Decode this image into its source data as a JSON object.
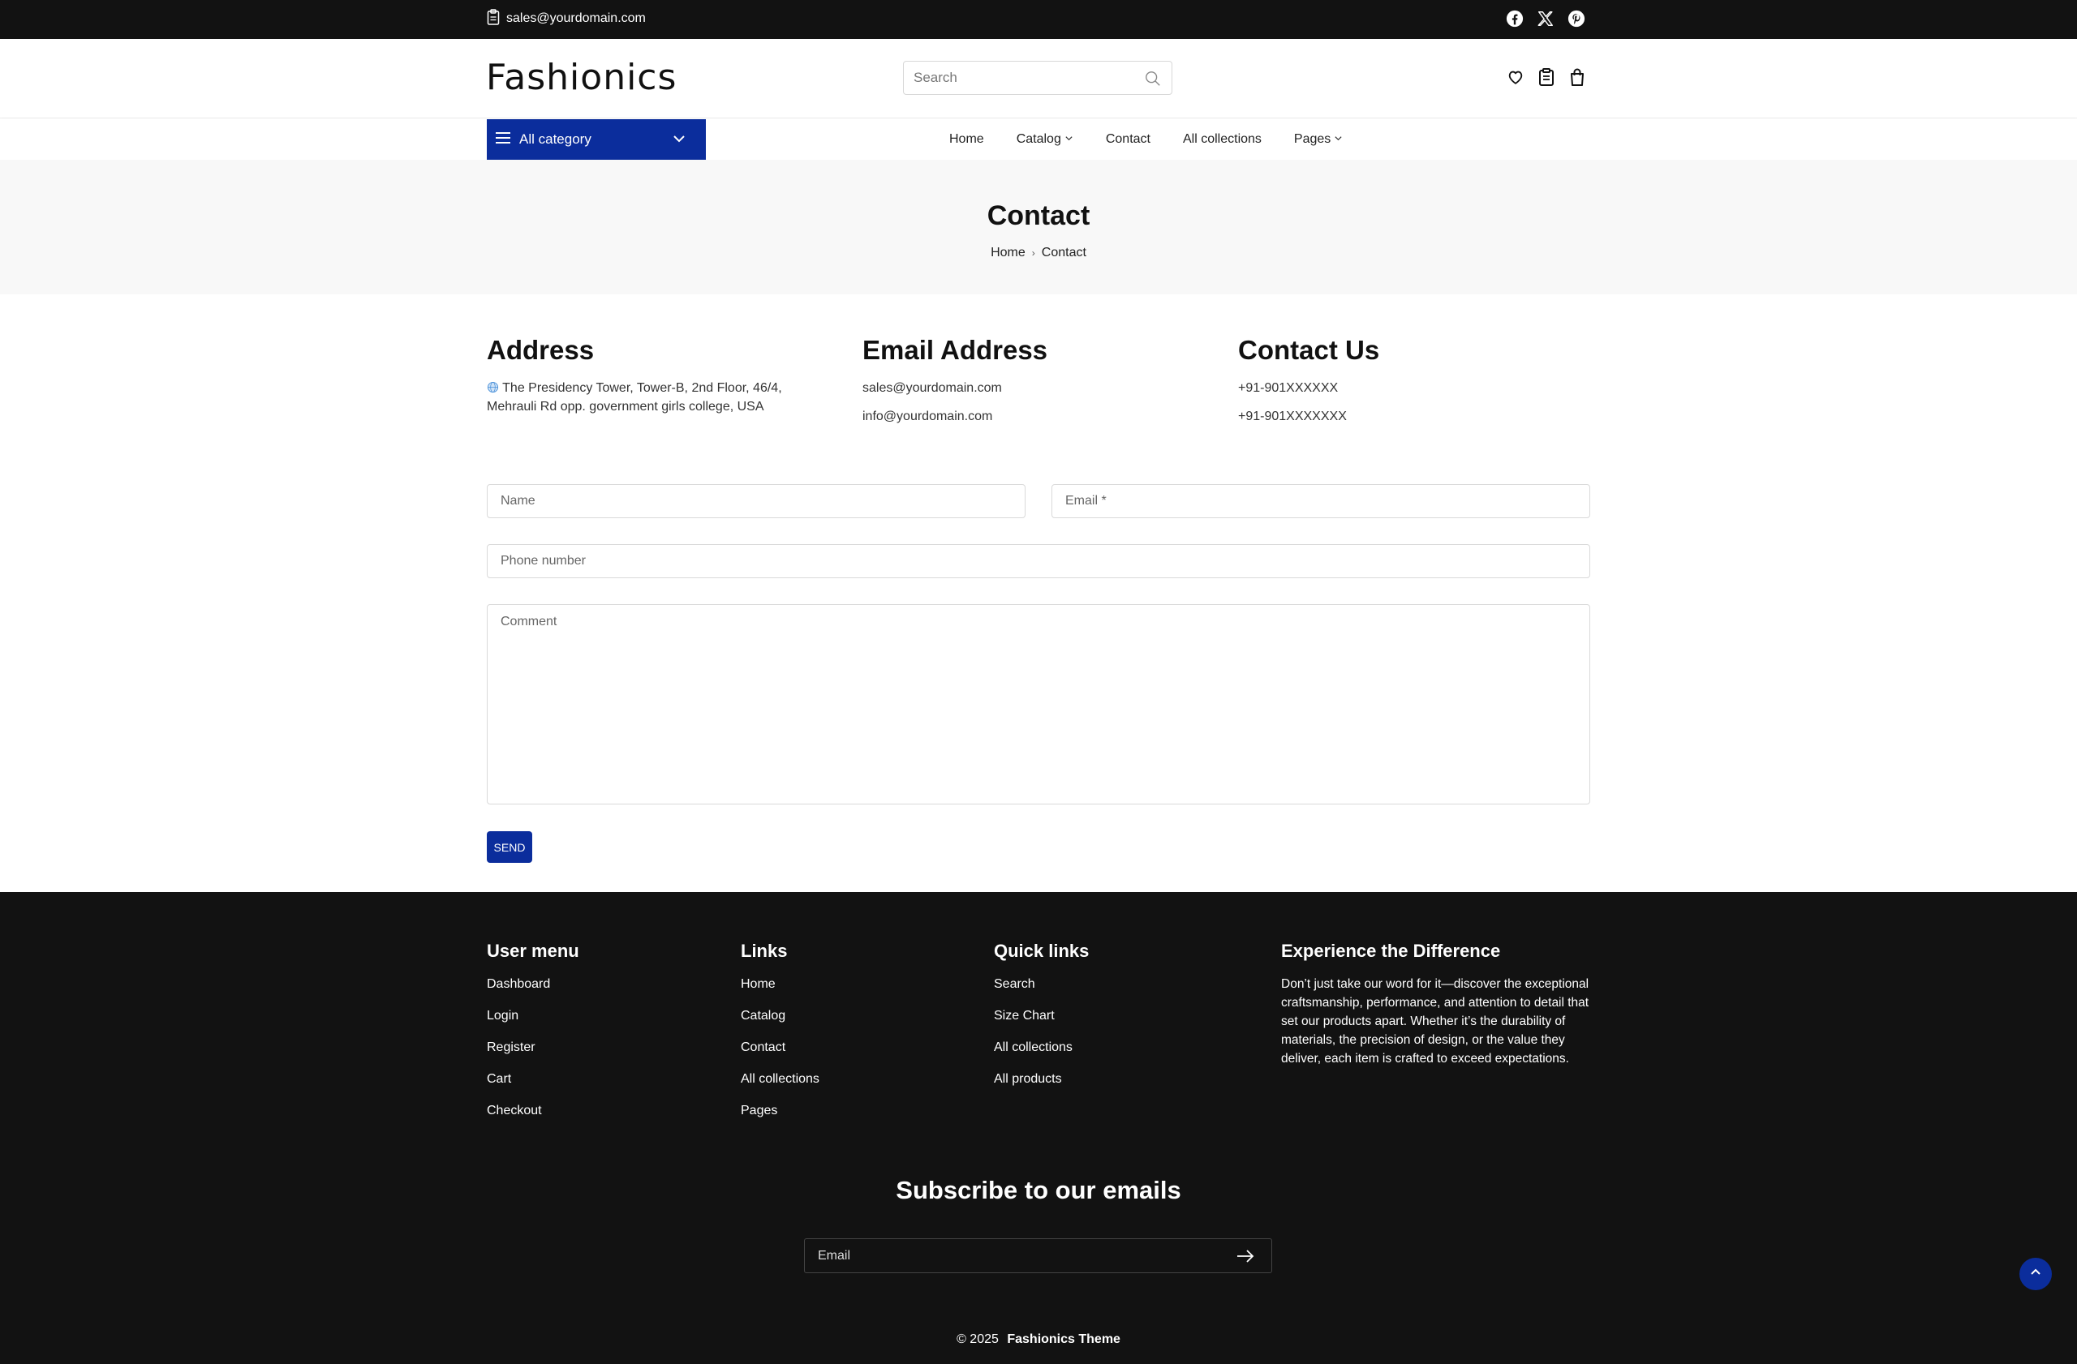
{
  "topbar": {
    "email": "sales@yourdomain.com",
    "social": [
      "facebook-icon",
      "x-icon",
      "pinterest-icon"
    ]
  },
  "header": {
    "logo": "Fashionics",
    "search_placeholder": "Search"
  },
  "nav": {
    "all_category": "All category",
    "items": [
      {
        "label": "Home",
        "has_dropdown": false
      },
      {
        "label": "Catalog",
        "has_dropdown": true
      },
      {
        "label": "Contact",
        "has_dropdown": false
      },
      {
        "label": "All collections",
        "has_dropdown": false
      },
      {
        "label": "Pages",
        "has_dropdown": true
      }
    ]
  },
  "page": {
    "title": "Contact",
    "breadcrumb": [
      "Home",
      "Contact"
    ]
  },
  "info": {
    "address": {
      "heading": "Address",
      "text": "The Presidency Tower, Tower-B, 2nd Floor, 46/4, Mehrauli Rd opp. government girls college, USA"
    },
    "email": {
      "heading": "Email Address",
      "lines": [
        "sales@yourdomain.com",
        "info@yourdomain.com"
      ]
    },
    "contact": {
      "heading": "Contact Us",
      "lines": [
        "+91-901XXXXXX",
        "+91-901XXXXXXX"
      ]
    }
  },
  "form": {
    "name_placeholder": "Name",
    "email_placeholder": "Email *",
    "phone_placeholder": "Phone number",
    "comment_placeholder": "Comment",
    "send_label": "SEND"
  },
  "footer": {
    "user_menu": {
      "heading": "User menu",
      "items": [
        "Dashboard",
        "Login",
        "Register",
        "Cart",
        "Checkout"
      ]
    },
    "links": {
      "heading": "Links",
      "items": [
        "Home",
        "Catalog",
        "Contact",
        "All collections",
        "Pages"
      ]
    },
    "quick_links": {
      "heading": "Quick links",
      "items": [
        "Search",
        "Size Chart",
        "All collections",
        "All products"
      ]
    },
    "experience": {
      "heading": "Experience the Difference",
      "text": "Don’t just take our word for it—discover the exceptional craftsmanship, performance, and attention to detail that set our products apart. Whether it’s the durability of materials, the precision of design, or the value they deliver, each item is crafted to exceed expectations."
    },
    "subscribe_title": "Subscribe to our emails",
    "subscribe_placeholder": "Email",
    "copyright_prefix": "© 2025",
    "copyright_brand": "Fashionics Theme"
  },
  "colors": {
    "accent": "#0b2d9c",
    "dark": "#121212"
  }
}
